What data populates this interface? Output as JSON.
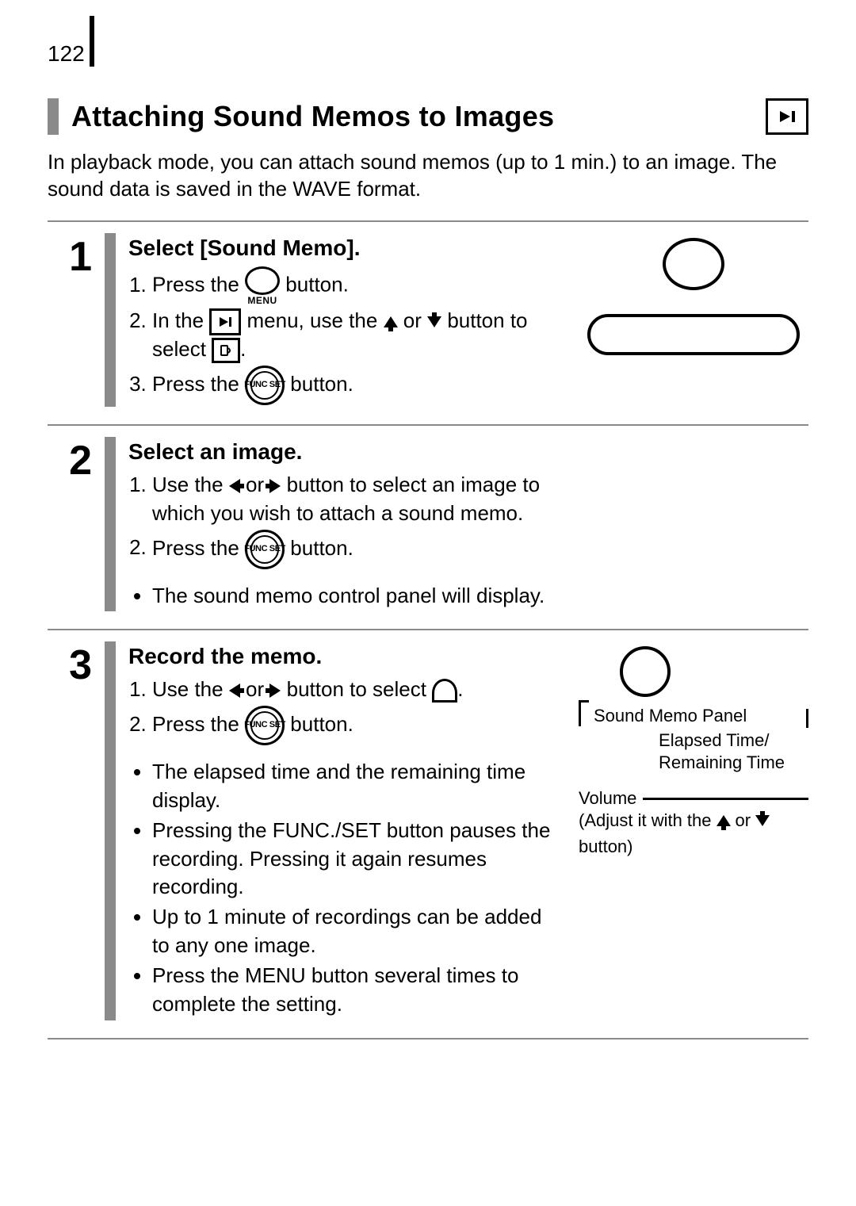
{
  "page_number": "122",
  "title": "Attaching Sound Memos to Images",
  "intro": "In playback mode, you can attach sound memos (up to 1 min.) to an image. The sound data is saved in the WAVE format.",
  "icons": {
    "menu_label": "MENU",
    "func_label": "FUNC\nSET"
  },
  "steps": [
    {
      "number": "1",
      "heading": "Select [Sound Memo].",
      "substeps": [
        {
          "pre": "Press the ",
          "mid_icon": "menu",
          "post": " button."
        },
        {
          "seq": [
            "In the ",
            {
              "icon": "play-menu"
            },
            " menu, use the ",
            {
              "icon": "up"
            },
            " or ",
            {
              "icon": "down"
            },
            " button to select ",
            {
              "icon": "memo"
            },
            "."
          ]
        },
        {
          "pre": "Press the ",
          "mid_icon": "func",
          "post": " button."
        }
      ]
    },
    {
      "number": "2",
      "heading": "Select an image.",
      "substeps": [
        {
          "seq": [
            "Use the ",
            {
              "icon": "left"
            },
            " or ",
            {
              "icon": "right"
            },
            " button to select an image to which you wish to attach a sound memo."
          ]
        },
        {
          "pre": "Press the ",
          "mid_icon": "func",
          "post": " button."
        }
      ],
      "bullets": [
        "The sound memo control panel will display."
      ]
    },
    {
      "number": "3",
      "heading": "Record the memo.",
      "substeps": [
        {
          "seq": [
            "Use the ",
            {
              "icon": "left"
            },
            " or ",
            {
              "icon": "right"
            },
            " button to select ",
            {
              "icon": "rec"
            },
            "."
          ]
        },
        {
          "pre": "Press the ",
          "mid_icon": "func",
          "post": " button."
        }
      ],
      "bullets": [
        "The elapsed time and the remaining time display.",
        "Pressing the FUNC./SET button pauses the recording. Pressing it again resumes recording.",
        "Up to 1 minute of recordings can be added to any one image.",
        "Press the MENU button several times to complete the setting."
      ],
      "diagram": {
        "panel_label": "Sound Memo Panel",
        "elapsed_label": "Elapsed Time/\nRemaining Time",
        "volume_label": "Volume",
        "adjust_pre": "(Adjust it with the ",
        "adjust_mid": " or ",
        "adjust_post": " button)"
      }
    }
  ]
}
